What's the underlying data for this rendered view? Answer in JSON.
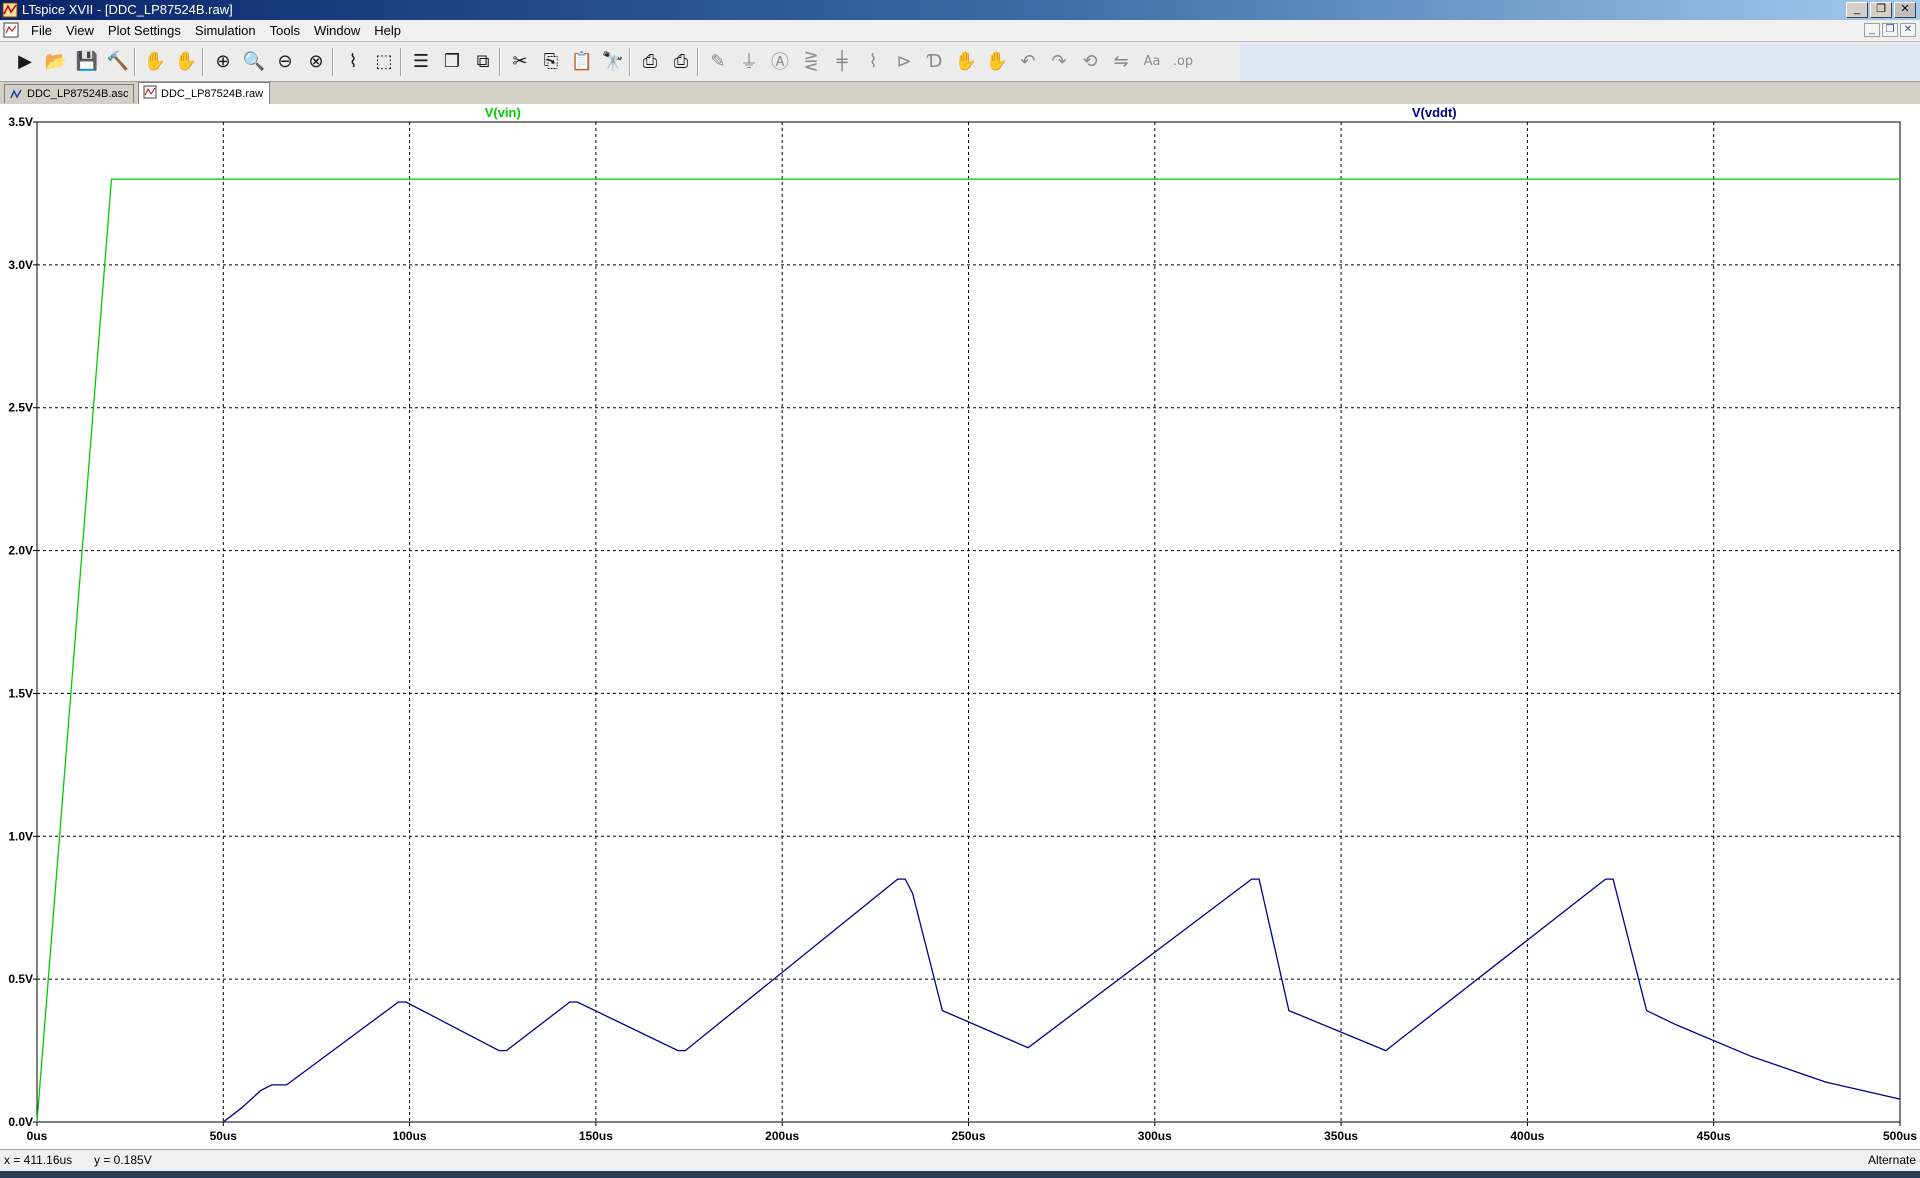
{
  "window": {
    "title": "LTspice XVII - [DDC_LP87524B.raw]"
  },
  "menu": {
    "items": [
      "File",
      "View",
      "Plot Settings",
      "Simulation",
      "Tools",
      "Window",
      "Help"
    ]
  },
  "toolbar": {
    "buttons": [
      "run-icon",
      "open-icon",
      "save-icon",
      "control-panel-icon",
      "halt-icon",
      "pan-hand-icon",
      "zoom-in-icon",
      "zoom-area-icon",
      "zoom-out-icon",
      "zoom-fit-icon",
      "autorange-icon",
      "zoom-extents-icon",
      "tile-horizontal-icon",
      "cascade-icon",
      "tile-vertical-icon",
      "cut-icon",
      "copy-icon",
      "paste-icon",
      "find-icon",
      "print-icon",
      "print-setup-icon",
      "draw-wire-icon",
      "ground-icon",
      "label-net-icon",
      "resistor-icon",
      "capacitor-icon",
      "inductor-icon",
      "diode-icon",
      "component-icon",
      "move-icon",
      "drag-icon",
      "undo-icon",
      "redo-icon",
      "rotate-icon",
      "mirror-icon",
      "text-icon",
      "spice-directive-icon"
    ]
  },
  "tabs": [
    {
      "label": "DDC_LP87524B.asc",
      "icon": "schematic-icon",
      "active": false
    },
    {
      "label": "DDC_LP87524B.raw",
      "icon": "waveform-icon",
      "active": true
    }
  ],
  "chart_data": {
    "type": "line",
    "xunit": "us",
    "yunit": "V",
    "xlim": [
      0,
      500
    ],
    "ylim": [
      0,
      3.5
    ],
    "xticks": [
      "0us",
      "50us",
      "100us",
      "150us",
      "200us",
      "250us",
      "300us",
      "350us",
      "400us",
      "450us",
      "500us"
    ],
    "yticks": [
      "0.0V",
      "0.5V",
      "1.0V",
      "1.5V",
      "2.0V",
      "2.5V",
      "3.0V",
      "3.5V"
    ],
    "grid": true,
    "series": [
      {
        "name": "V(vin)",
        "color": "#00cc00",
        "x": [
          0,
          20,
          500
        ],
        "y": [
          0.0,
          3.3,
          3.3
        ]
      },
      {
        "name": "V(vddt)",
        "color": "#00008b",
        "x": [
          50,
          55,
          60,
          63,
          67,
          97,
          99,
          124,
          126,
          143,
          145,
          172,
          174,
          231,
          233,
          235,
          243,
          266,
          326,
          328,
          336,
          362,
          421,
          423,
          432,
          440,
          460,
          480,
          500
        ],
        "y": [
          0.0,
          0.05,
          0.11,
          0.13,
          0.13,
          0.42,
          0.42,
          0.25,
          0.25,
          0.42,
          0.42,
          0.25,
          0.25,
          0.85,
          0.85,
          0.8,
          0.39,
          0.26,
          0.85,
          0.85,
          0.39,
          0.25,
          0.85,
          0.85,
          0.39,
          0.34,
          0.23,
          0.14,
          0.08
        ]
      }
    ]
  },
  "status": {
    "cursor_x": "x = 411.16us",
    "cursor_y": "y = 0.185V",
    "mode": "Alternate"
  }
}
